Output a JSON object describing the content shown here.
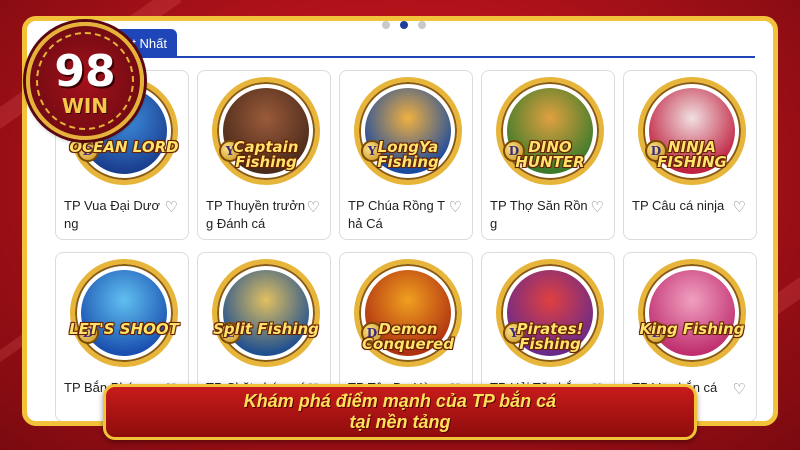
{
  "brand": {
    "number": "98",
    "text": "WIN"
  },
  "pager": {
    "dots": 3,
    "active_index": 1
  },
  "tab": {
    "label": "Hot Nhất"
  },
  "games": [
    {
      "name": "TP Vua Đại Dương",
      "logo": "OCEAN LORD",
      "badge": "D",
      "colors": [
        "#1b3f8f",
        "#3f8fe0"
      ]
    },
    {
      "name": "TP Thuyền trưởng Đánh cá",
      "logo": "Captain Fishing",
      "badge": "Y",
      "colors": [
        "#4a2a1a",
        "#9a5a3a"
      ]
    },
    {
      "name": "TP Chúa Rồng Thả Cá",
      "logo": "LongYa Fishing",
      "badge": "Y",
      "colors": [
        "#1a4aa0",
        "#f0b040"
      ]
    },
    {
      "name": "TP Thợ Săn Rồng",
      "logo": "DINO HUNTER",
      "badge": "D",
      "colors": [
        "#3a7a2a",
        "#e0a040"
      ]
    },
    {
      "name": "TP Câu cá ninja",
      "logo": "NINJA FISHING",
      "badge": "D",
      "colors": [
        "#c02040",
        "#f0e0e0"
      ]
    },
    {
      "name": "TP Bắn Pháo",
      "logo": "LET'S SHOOT",
      "badge": "D",
      "colors": [
        "#1a50b0",
        "#60c0f0"
      ]
    },
    {
      "name": "TP Chặt chém cá",
      "logo": "Split Fishing",
      "badge": "L",
      "colors": [
        "#205090",
        "#e0c060"
      ]
    },
    {
      "name": "TP Tây Du Hàng",
      "logo": "Demon Conquered",
      "badge": "D",
      "colors": [
        "#b03010",
        "#f0a020"
      ]
    },
    {
      "name": "TP Hải Tặc bắn",
      "logo": "Pirates! Fishing",
      "badge": "Y",
      "colors": [
        "#6a2a8a",
        "#e04040"
      ]
    },
    {
      "name": "TP Vua bắn cá",
      "logo": "King Fishing",
      "badge": "L",
      "colors": [
        "#c03070",
        "#f0a0c0"
      ]
    }
  ],
  "heart_icon": "♡",
  "banner": {
    "line1": "Khám phá điểm mạnh của TP bắn cá",
    "line2": "tại nền tảng"
  }
}
